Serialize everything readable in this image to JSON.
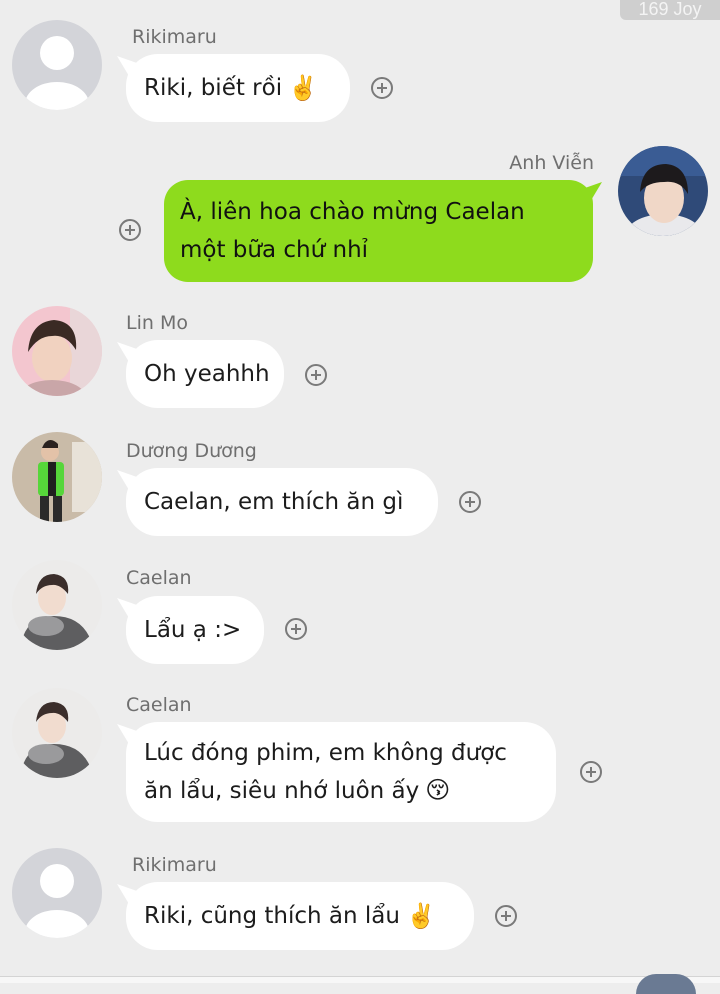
{
  "watermark": "169 Joy",
  "messages": [
    {
      "sender": "Rikimaru",
      "text": "Riki, biết rồi",
      "emoji": "✌️"
    },
    {
      "sender": "Anh Viễn",
      "text": "À, liên hoa chào mừng Caelan một bữa chứ nhỉ"
    },
    {
      "sender": "Lin Mo",
      "text": "Oh yeahhh"
    },
    {
      "sender": "Dương Dương",
      "text": "Caelan, em thích ăn gì"
    },
    {
      "sender": "Caelan",
      "text": "Lẩu ạ :>"
    },
    {
      "sender": "Caelan",
      "text": "Lúc đóng phim, em không được ăn lẩu, siêu nhớ luôn ấy",
      "emoji": "😚"
    },
    {
      "sender": "Rikimaru",
      "text": "Riki, cũng thích ăn lẩu",
      "emoji": "✌️"
    }
  ],
  "colors": {
    "background": "#ededed",
    "incoming_bubble": "#ffffff",
    "outgoing_bubble": "#8edb1d",
    "sender_name": "#6f6f6f"
  },
  "icons": {
    "reaction": "plus-circle-icon",
    "default_avatar": "default-avatar-icon"
  }
}
